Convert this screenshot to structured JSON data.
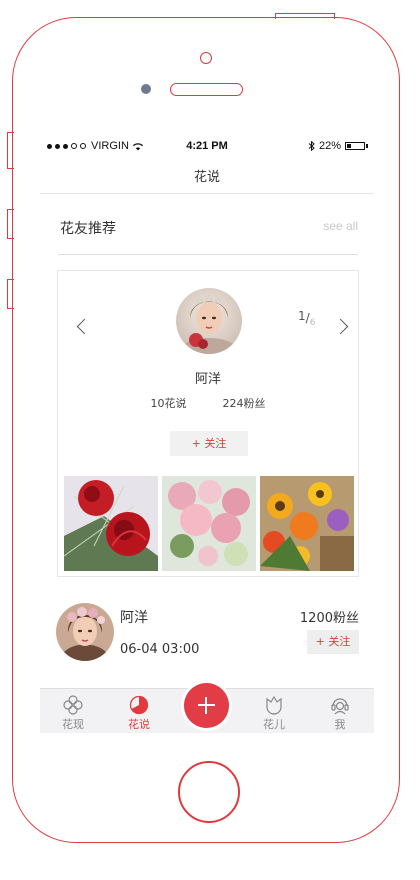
{
  "status_bar": {
    "carrier": "VIRGIN",
    "time": "4:21 PM",
    "battery": "22%",
    "battery_level": 0.22
  },
  "nav": {
    "title": "花说"
  },
  "section": {
    "title": "花友推荐",
    "see_all": "see all"
  },
  "recommend_card": {
    "page_current": "1",
    "page_total": "6",
    "name": "阿洋",
    "posts": "10花说",
    "fans": "224粉丝",
    "follow_label": "+ 关注"
  },
  "user_row": {
    "name": "阿洋",
    "date": "06-04 03:00",
    "fans": "1200粉丝",
    "follow_label": "+ 关注"
  },
  "tabs": [
    {
      "label": "花现",
      "icon": "flower-outline-icon",
      "active": false
    },
    {
      "label": "花说",
      "icon": "huashuo-icon",
      "active": true
    },
    {
      "label": "花儿",
      "icon": "tulip-icon",
      "active": false
    },
    {
      "label": "我",
      "icon": "user-headset-icon",
      "active": false
    }
  ],
  "colors": {
    "accent": "#e03a3e",
    "fab": "#e23c47",
    "tabbar": "#f2f2f4"
  }
}
